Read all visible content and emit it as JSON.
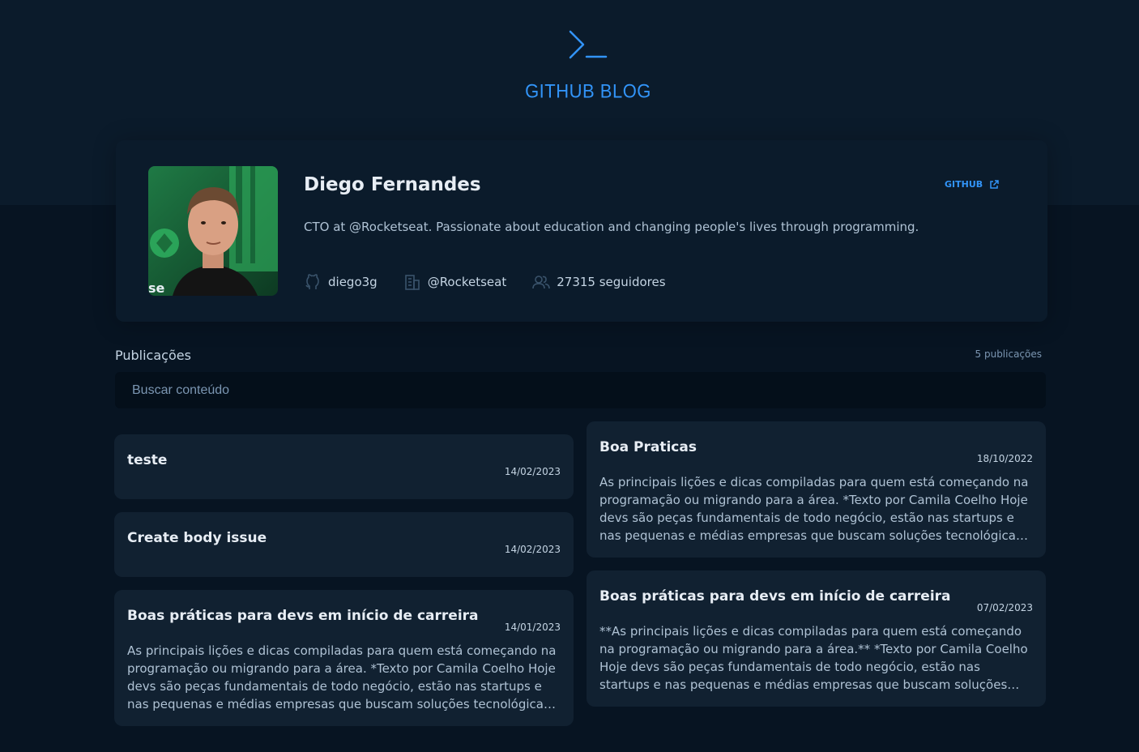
{
  "header": {
    "logo_icon": "terminal-prompt-icon",
    "title": "GITHUB BLOG"
  },
  "profile": {
    "name": "Diego Fernandes",
    "github_label": "GITHUB",
    "bio": "CTO at @Rocketseat. Passionate about education and changing people's lives through programming.",
    "username": "diego3g",
    "company": "@Rocketseat",
    "followers": "27315 seguidores"
  },
  "publications": {
    "title": "Publicações",
    "count": "5 publicações",
    "search_placeholder": "Buscar conteúdo"
  },
  "posts": [
    {
      "title": "teste",
      "date": "14/02/2023",
      "excerpt": ""
    },
    {
      "title": "Create body issue",
      "date": "14/02/2023",
      "excerpt": ""
    },
    {
      "title": "Boas práticas para devs em início de carreira",
      "date": "14/01/2023",
      "excerpt": "As principais lições e dicas compiladas para quem está começando na programação ou migrando para a área. *Texto por Camila Coelho Hoje devs são peças fundamentais de todo negócio, estão nas startups e nas pequenas e médias empresas que buscam soluções tecnológicas para..."
    },
    {
      "title": "Boa Praticas",
      "date": "18/10/2022",
      "excerpt": "As principais lições e dicas compiladas para quem está começando na programação ou migrando para a área. *Texto por Camila Coelho Hoje devs são peças fundamentais de todo negócio, estão nas startups e nas pequenas e médias empresas que buscam soluções tecnológicas para..."
    },
    {
      "title": "Boas práticas para devs em início de carreira",
      "date": "07/02/2023",
      "excerpt": "**As principais lições e dicas compiladas para quem está começando na programação ou migrando para a área.** *Texto por Camila Coelho Hoje devs são peças fundamentais de todo negócio, estão nas startups e nas pequenas e médias empresas que buscam soluções tecnológicas para..."
    }
  ],
  "colors": {
    "accent": "#3294f8",
    "background": "#071422",
    "card": "#112131"
  }
}
